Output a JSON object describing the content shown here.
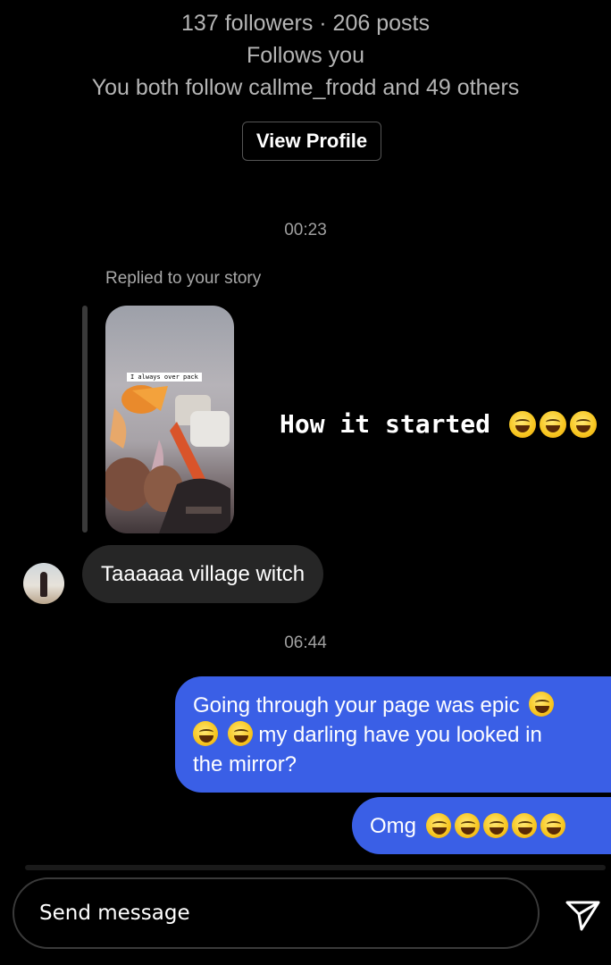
{
  "profile": {
    "stats": "137 followers · 206 posts",
    "follows_you": "Follows you",
    "mutuals": "You both follow callme_frodd and 49 others",
    "view_profile_label": "View Profile"
  },
  "thread": {
    "timestamp_1": "00:23",
    "story_reply": {
      "label": "Replied to your story",
      "thumbnail_caption": "I always over pack",
      "story_text": "How it started"
    },
    "incoming_message": "Taaaaaa village witch",
    "timestamp_2": "06:44",
    "outgoing_1": {
      "line1": "Going through your page was epic",
      "line2": "my darling have you looked in",
      "line3": "the mirror?"
    },
    "outgoing_2": "Omg"
  },
  "composer": {
    "placeholder": "Send message",
    "send_icon": "send-paper-plane-icon"
  },
  "colors": {
    "background": "#000000",
    "outgoing_bubble": "#3a5fe6",
    "incoming_bubble": "#262626",
    "emoji": "rolling-on-floor-laughing"
  }
}
